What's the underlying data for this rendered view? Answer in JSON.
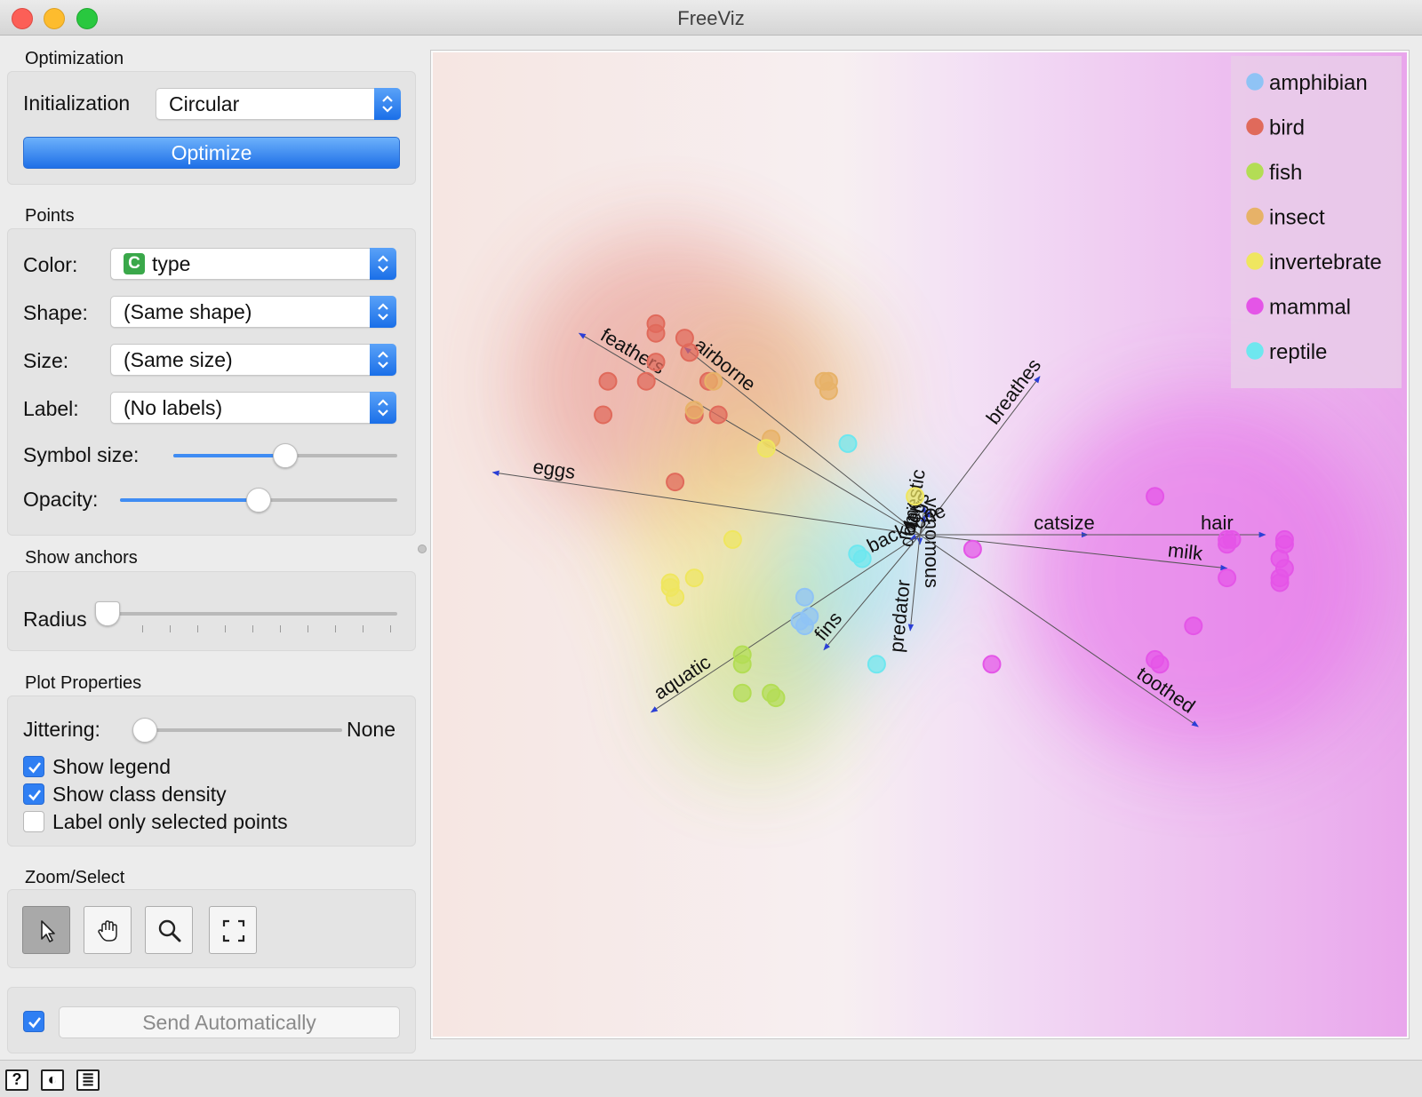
{
  "window": {
    "title": "FreeViz"
  },
  "optimization": {
    "title": "Optimization",
    "initialization_label": "Initialization",
    "initialization_value": "Circular",
    "optimize_label": "Optimize"
  },
  "points": {
    "title": "Points",
    "color_label": "Color:",
    "color_tag": "C",
    "color_value": "type",
    "shape_label": "Shape:",
    "shape_value": "(Same shape)",
    "size_label": "Size:",
    "size_value": "(Same size)",
    "label_label": "Label:",
    "label_value": "(No labels)",
    "symbol_size_label": "Symbol size:",
    "symbol_size_level": 0.5,
    "opacity_label": "Opacity:",
    "opacity_level": 0.5
  },
  "anchors": {
    "title": "Show anchors",
    "radius_label": "Radius",
    "radius_level": 0
  },
  "plot_properties": {
    "title": "Plot Properties",
    "jittering_label": "Jittering:",
    "jittering_value": "None",
    "show_legend_label": "Show legend",
    "show_legend": true,
    "show_density_label": "Show class density",
    "show_density": true,
    "label_selected_label": "Label only selected points",
    "label_selected": false
  },
  "zoom_select": {
    "title": "Zoom/Select",
    "tools": [
      "select-icon",
      "pan-hand-icon",
      "zoom-icon",
      "reset-zoom-icon"
    ],
    "active_tool": "select-icon"
  },
  "send": {
    "auto_checked": true,
    "label": "Send Automatically"
  },
  "status_icons": [
    "help-icon",
    "report-icon",
    "log-icon"
  ],
  "status_glyphs": [
    "?",
    "◐",
    "≣"
  ],
  "legend": [
    {
      "name": "amphibian",
      "color": "#8fc3f5"
    },
    {
      "name": "bird",
      "color": "#e06a5b"
    },
    {
      "name": "fish",
      "color": "#b3dd55"
    },
    {
      "name": "insect",
      "color": "#e7b268"
    },
    {
      "name": "invertebrate",
      "color": "#efe65f"
    },
    {
      "name": "mammal",
      "color": "#e455e7"
    },
    {
      "name": "reptile",
      "color": "#6ee7ef"
    }
  ],
  "anchor_labels": [
    "feathers",
    "airborne",
    "eggs",
    "breathes",
    "domestic",
    "legs",
    "tail",
    "backbone",
    "venomous",
    "catsize",
    "hair",
    "milk",
    "toothed",
    "predator",
    "fins",
    "aquatic"
  ],
  "chart_data": {
    "type": "scatter",
    "title": "",
    "xlabel": "",
    "ylabel": "",
    "series": [
      {
        "name": "amphibian",
        "points": [
          [
            -0.24,
            -0.13
          ],
          [
            -0.23,
            -0.17
          ],
          [
            -0.25,
            -0.18
          ],
          [
            -0.24,
            -0.19
          ]
        ]
      },
      {
        "name": "bird",
        "points": [
          [
            -0.55,
            0.44
          ],
          [
            -0.55,
            0.42
          ],
          [
            -0.49,
            0.41
          ],
          [
            -0.48,
            0.38
          ],
          [
            -0.65,
            0.32
          ],
          [
            -0.57,
            0.32
          ],
          [
            -0.55,
            0.36
          ],
          [
            -0.66,
            0.25
          ],
          [
            -0.44,
            0.32
          ],
          [
            -0.47,
            0.25
          ],
          [
            -0.42,
            0.25
          ],
          [
            -0.51,
            0.11
          ]
        ]
      },
      {
        "name": "fish",
        "points": [
          [
            -0.37,
            -0.25
          ],
          [
            -0.37,
            -0.27
          ],
          [
            -0.37,
            -0.33
          ],
          [
            -0.31,
            -0.33
          ],
          [
            -0.3,
            -0.34
          ]
        ]
      },
      {
        "name": "insect",
        "points": [
          [
            -0.47,
            0.26
          ],
          [
            -0.43,
            0.32
          ],
          [
            -0.2,
            0.32
          ],
          [
            -0.19,
            0.32
          ],
          [
            -0.19,
            0.3
          ],
          [
            -0.31,
            0.2
          ]
        ]
      },
      {
        "name": "invertebrate",
        "points": [
          [
            -0.32,
            0.18
          ],
          [
            -0.01,
            0.08
          ],
          [
            -0.39,
            -0.01
          ],
          [
            -0.52,
            -0.1
          ],
          [
            -0.52,
            -0.11
          ],
          [
            -0.47,
            -0.09
          ],
          [
            -0.51,
            -0.13
          ]
        ]
      },
      {
        "name": "mammal",
        "points": [
          [
            0.49,
            0.08
          ],
          [
            0.11,
            -0.03
          ],
          [
            0.64,
            -0.01
          ],
          [
            0.65,
            -0.01
          ],
          [
            0.64,
            -0.02
          ],
          [
            0.76,
            -0.01
          ],
          [
            0.76,
            -0.02
          ],
          [
            0.75,
            -0.05
          ],
          [
            0.76,
            -0.07
          ],
          [
            0.75,
            -0.09
          ],
          [
            0.64,
            -0.09
          ],
          [
            0.75,
            -0.1
          ],
          [
            0.57,
            -0.19
          ],
          [
            0.15,
            -0.27
          ],
          [
            0.49,
            -0.26
          ],
          [
            0.5,
            -0.27
          ]
        ]
      },
      {
        "name": "reptile",
        "points": [
          [
            -0.15,
            0.19
          ],
          [
            -0.13,
            -0.04
          ],
          [
            -0.12,
            -0.05
          ],
          [
            -0.09,
            -0.27
          ]
        ]
      }
    ],
    "anchors": [
      {
        "name": "feathers",
        "x": -0.71,
        "y": 0.42
      },
      {
        "name": "airborne",
        "x": -0.49,
        "y": 0.39
      },
      {
        "name": "eggs",
        "x": -0.89,
        "y": 0.13
      },
      {
        "name": "breathes",
        "x": 0.25,
        "y": 0.33
      },
      {
        "name": "domestic",
        "x": 0.01,
        "y": 0.06
      },
      {
        "name": "legs",
        "x": 0.02,
        "y": 0.05
      },
      {
        "name": "tail",
        "x": 0.01,
        "y": 0.04
      },
      {
        "name": "backbone",
        "x": -0.02,
        "y": -0.01
      },
      {
        "name": "venomous",
        "x": 0.0,
        "y": -0.02
      },
      {
        "name": "catsize",
        "x": 0.35,
        "y": 0.0
      },
      {
        "name": "hair",
        "x": 0.72,
        "y": 0.0
      },
      {
        "name": "milk",
        "x": 0.64,
        "y": -0.07
      },
      {
        "name": "toothed",
        "x": 0.58,
        "y": -0.4
      },
      {
        "name": "predator",
        "x": -0.02,
        "y": -0.2
      },
      {
        "name": "fins",
        "x": -0.2,
        "y": -0.24
      },
      {
        "name": "aquatic",
        "x": -0.56,
        "y": -0.37
      }
    ],
    "legend_position": "top-right"
  }
}
